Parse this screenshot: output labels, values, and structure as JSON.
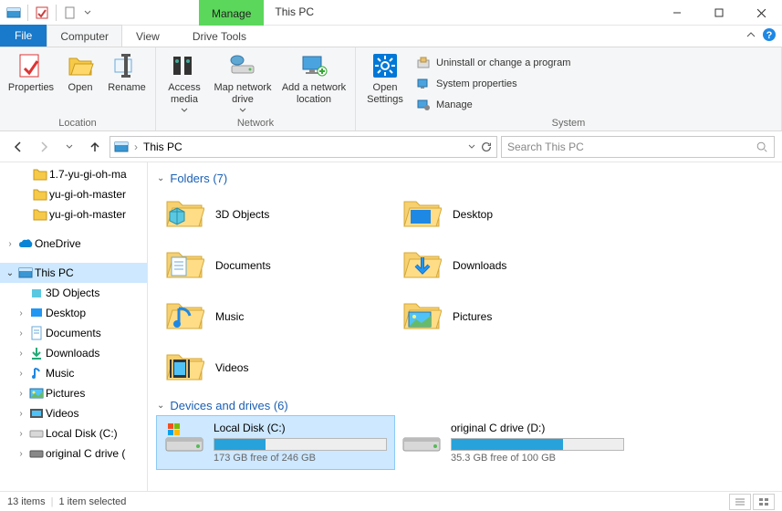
{
  "title": "This PC",
  "context_tab": "Manage",
  "context_group": "Drive Tools",
  "tabs": {
    "file": "File",
    "computer": "Computer",
    "view": "View"
  },
  "ribbon": {
    "location": {
      "label": "Location",
      "properties": "Properties",
      "open": "Open",
      "rename": "Rename"
    },
    "network": {
      "label": "Network",
      "access_media": "Access media",
      "map_drive": "Map network drive",
      "add_location": "Add a network location"
    },
    "system": {
      "label": "System",
      "open_settings": "Open Settings",
      "uninstall": "Uninstall or change a program",
      "properties": "System properties",
      "manage": "Manage"
    }
  },
  "breadcrumb": "This PC",
  "search_placeholder": "Search This PC",
  "tree": {
    "top_folders": [
      "1.7-yu-gi-oh-ma",
      "yu-gi-oh-master",
      "yu-gi-oh-master"
    ],
    "onedrive": "OneDrive",
    "this_pc": "This PC",
    "children": [
      "3D Objects",
      "Desktop",
      "Documents",
      "Downloads",
      "Music",
      "Pictures",
      "Videos",
      "Local Disk (C:)",
      "original C drive ("
    ]
  },
  "sections": {
    "folders": {
      "title": "Folders (7)",
      "items": [
        "3D Objects",
        "Desktop",
        "Documents",
        "Downloads",
        "Music",
        "Pictures",
        "Videos"
      ]
    },
    "drives": {
      "title": "Devices and drives (6)",
      "items": [
        {
          "name": "Local Disk (C:)",
          "free": "173 GB free of 246 GB",
          "fill_pct": 30,
          "selected": true,
          "os": true
        },
        {
          "name": "original C drive (D:)",
          "free": "35.3 GB free of 100 GB",
          "fill_pct": 65,
          "selected": false,
          "os": false
        }
      ]
    }
  },
  "status": {
    "items": "13 items",
    "selected": "1 item selected"
  }
}
